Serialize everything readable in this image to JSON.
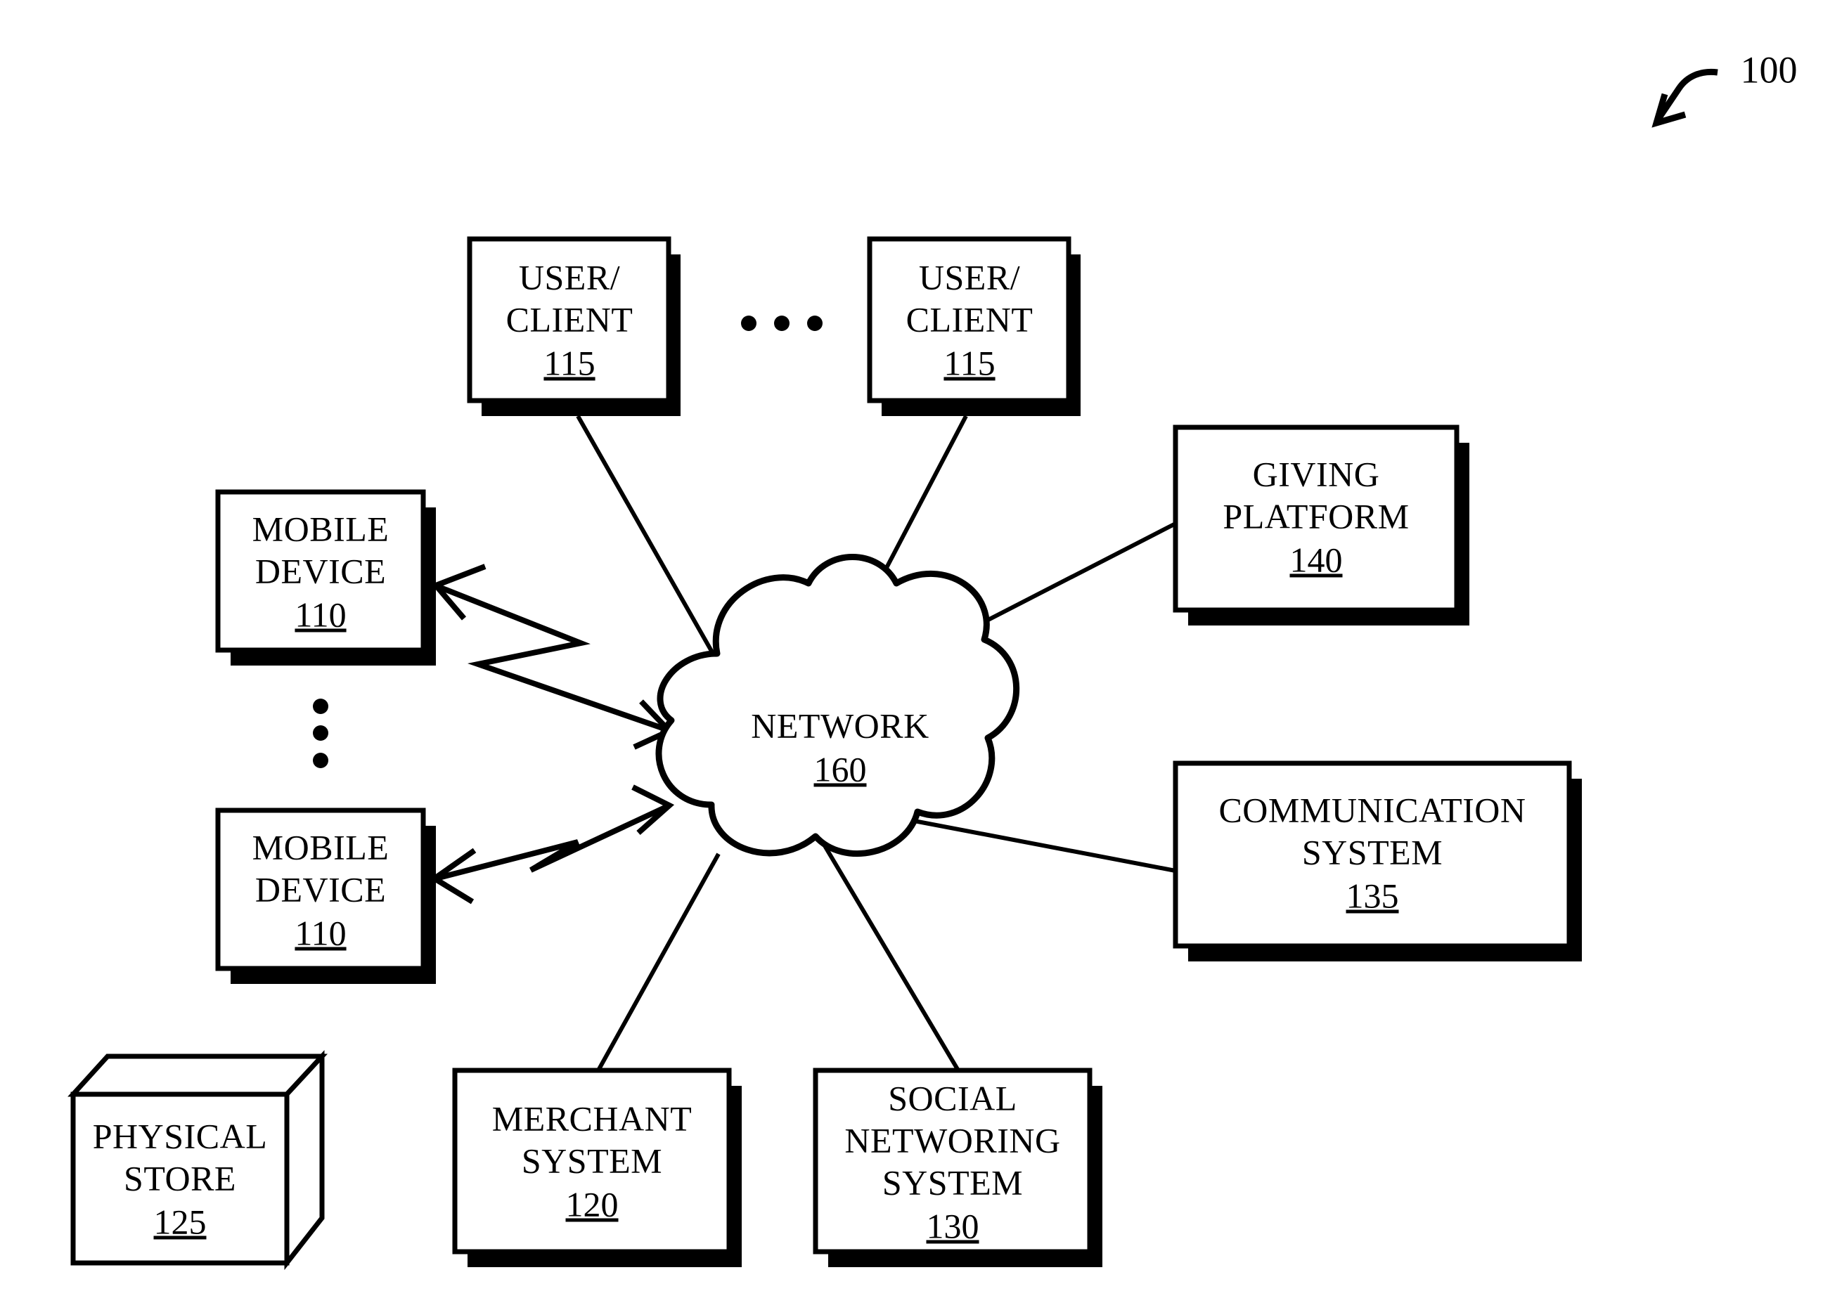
{
  "figure": {
    "reference_numeral": "100",
    "background_color": "#ffffff",
    "line_color": "#000000"
  },
  "nodes": {
    "user_client_left": {
      "line1": "USER/",
      "line2": "CLIENT",
      "ref": "115"
    },
    "user_client_right": {
      "line1": "USER/",
      "line2": "CLIENT",
      "ref": "115"
    },
    "mobile_device_top": {
      "line1": "MOBILE",
      "line2": "DEVICE",
      "ref": "110"
    },
    "mobile_device_bottom": {
      "line1": "MOBILE",
      "line2": "DEVICE",
      "ref": "110"
    },
    "physical_store": {
      "line1": "PHYSICAL",
      "line2": "STORE",
      "ref": "125"
    },
    "merchant_system": {
      "line1": "MERCHANT",
      "line2": "SYSTEM",
      "ref": "120"
    },
    "social_networking_system": {
      "line1": "SOCIAL",
      "line2": "NETWORING",
      "line3": "SYSTEM",
      "ref": "130"
    },
    "giving_platform": {
      "line1": "GIVING",
      "line2": "PLATFORM",
      "ref": "140"
    },
    "communication_system": {
      "line1": "COMMUNICATION",
      "line2": "SYSTEM",
      "ref": "135"
    },
    "network_cloud": {
      "line1": "NETWORK",
      "ref": "160"
    }
  },
  "ellipses": {
    "between_user_clients": "• • •",
    "between_mobile_devices": "vertical-three-dots"
  },
  "connections": [
    {
      "from": "user_client_left",
      "to": "network_cloud",
      "style": "plain-line"
    },
    {
      "from": "user_client_right",
      "to": "network_cloud",
      "style": "plain-line"
    },
    {
      "from": "giving_platform",
      "to": "network_cloud",
      "style": "plain-line"
    },
    {
      "from": "communication_system",
      "to": "network_cloud",
      "style": "plain-line"
    },
    {
      "from": "merchant_system",
      "to": "network_cloud",
      "style": "plain-line"
    },
    {
      "from": "social_networking_system",
      "to": "network_cloud",
      "style": "plain-line"
    },
    {
      "from": "mobile_device_top",
      "to": "network_cloud",
      "style": "zigzag-double-arrow"
    },
    {
      "from": "mobile_device_bottom",
      "to": "network_cloud",
      "style": "zigzag-double-arrow"
    }
  ]
}
